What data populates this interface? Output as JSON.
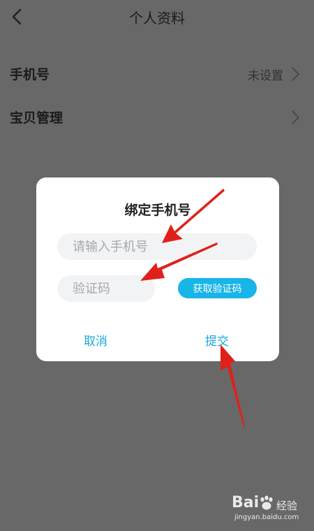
{
  "header": {
    "title": "个人资料"
  },
  "rows": [
    {
      "label": "手机号",
      "value": "未设置"
    },
    {
      "label": "宝贝管理",
      "value": ""
    }
  ],
  "dialog": {
    "title": "绑定手机号",
    "phone_placeholder": "请输入手机号",
    "code_placeholder": "验证码",
    "get_code_label": "获取验证码",
    "cancel_label": "取消",
    "submit_label": "提交"
  },
  "watermark": {
    "brand": "Bai",
    "sub": "经验",
    "url": "jingyan.baidu.com"
  },
  "colors": {
    "accent": "#18b5e8",
    "overlay": "#686868",
    "arrow": "#e0201b"
  }
}
